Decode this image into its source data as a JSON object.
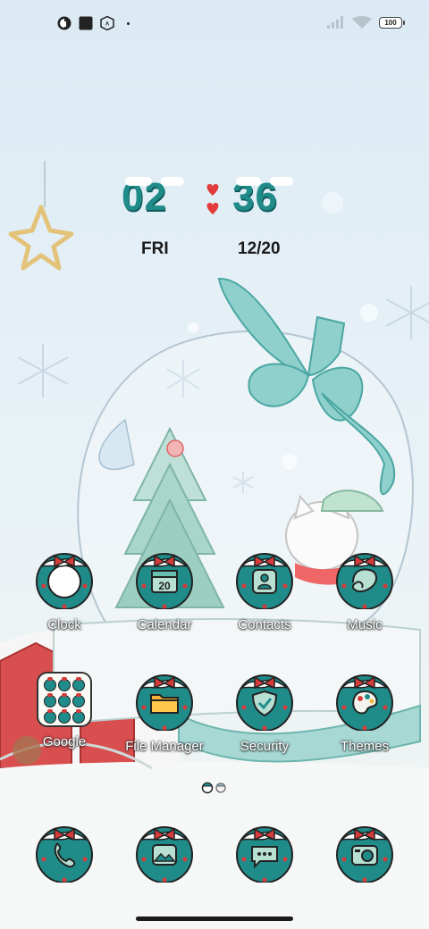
{
  "status_bar": {
    "left_icons": [
      "app-notification-icon",
      "square-notification-icon",
      "badge-notification-icon",
      "more-notifications-dot"
    ],
    "battery_level": "100",
    "right_icons": [
      "signal-icon",
      "wifi-icon",
      "battery-icon"
    ]
  },
  "clock_widget": {
    "hours": "02",
    "minutes": "36",
    "day": "FRI",
    "date": "12/20",
    "accent_color": "#1f8c8a",
    "heart_color": "#e23b3b"
  },
  "apps": [
    {
      "label": "Clock",
      "icon": "clock-icon"
    },
    {
      "label": "Calendar",
      "icon": "calendar-icon",
      "badge_text": "20"
    },
    {
      "label": "Contacts",
      "icon": "contacts-icon"
    },
    {
      "label": "Music",
      "icon": "music-icon"
    },
    {
      "label": "Google",
      "icon": "google-folder-icon"
    },
    {
      "label": "File Manager",
      "icon": "folder-icon"
    },
    {
      "label": "Security",
      "icon": "shield-icon"
    },
    {
      "label": "Themes",
      "icon": "palette-icon"
    }
  ],
  "dock": [
    {
      "icon": "phone-icon"
    },
    {
      "icon": "gallery-icon"
    },
    {
      "icon": "messages-icon"
    },
    {
      "icon": "camera-icon"
    }
  ],
  "theme": {
    "wreath_color": "#1f8c8a",
    "bow_color": "#d63b3b",
    "label_color": "#ffffff"
  }
}
